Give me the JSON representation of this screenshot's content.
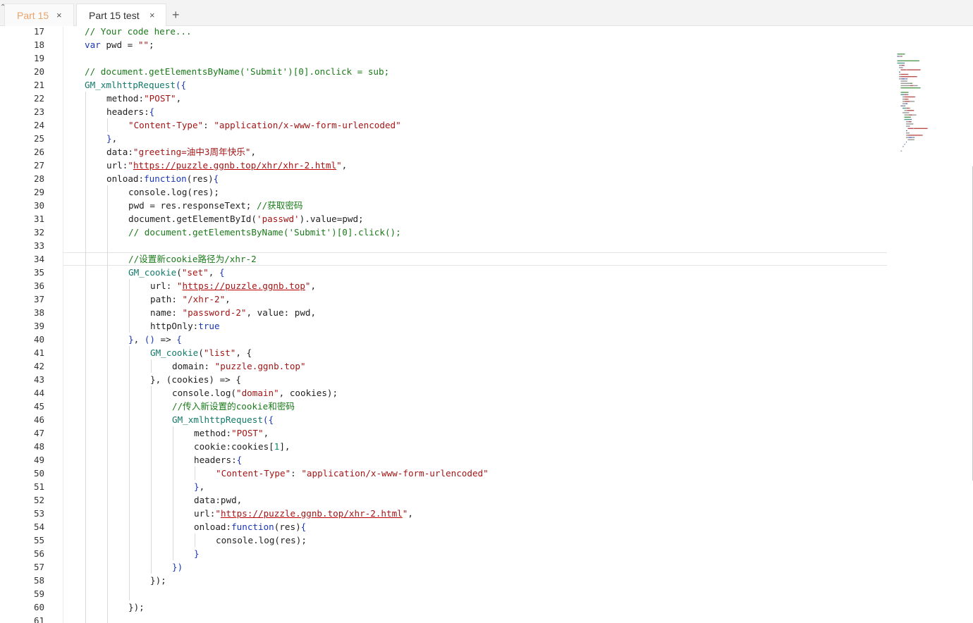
{
  "tabs": [
    {
      "label": "Part 15",
      "active": false
    },
    {
      "label": "Part 15 test",
      "active": true
    }
  ],
  "tab_close_glyph": "×",
  "add_tab_glyph": "+",
  "colors": {
    "comment": "#1a7a1a",
    "keyword": "#1a36b8",
    "string": "#a31515",
    "function": "#127a6a",
    "inactive_tab_text": "#e9a46a"
  },
  "editor": {
    "active_line": 34,
    "lines": [
      {
        "n": "17",
        "indent": 1,
        "tokens": [
          [
            "// Your code here...",
            "com"
          ]
        ]
      },
      {
        "n": "18",
        "indent": 1,
        "tokens": [
          [
            "var",
            "kw"
          ],
          [
            " pwd = ",
            ""
          ],
          [
            "\"\"",
            "str"
          ],
          [
            ";",
            ""
          ]
        ]
      },
      {
        "n": "19",
        "indent": 0,
        "tokens": []
      },
      {
        "n": "20",
        "indent": 1,
        "tokens": [
          [
            "// document.getElementsByName('Submit')[0].onclick = sub;",
            "com"
          ]
        ]
      },
      {
        "n": "21",
        "indent": 1,
        "tokens": [
          [
            "GM_xmlhttpRequest",
            "fn"
          ],
          [
            "({",
            "kw"
          ]
        ]
      },
      {
        "n": "22",
        "indent": 2,
        "tokens": [
          [
            "method:",
            ""
          ],
          [
            "\"POST\"",
            "str"
          ],
          [
            ",",
            ""
          ]
        ]
      },
      {
        "n": "23",
        "indent": 2,
        "tokens": [
          [
            "headers:",
            ""
          ],
          [
            "{",
            "kw"
          ]
        ]
      },
      {
        "n": "24",
        "indent": 3,
        "tokens": [
          [
            "\"Content-Type\"",
            "str"
          ],
          [
            ": ",
            ""
          ],
          [
            "\"application/x-www-form-urlencoded\"",
            "str"
          ]
        ]
      },
      {
        "n": "25",
        "indent": 2,
        "tokens": [
          [
            "}",
            "kw"
          ],
          [
            ",",
            ""
          ]
        ]
      },
      {
        "n": "26",
        "indent": 2,
        "tokens": [
          [
            "data:",
            ""
          ],
          [
            "\"greeting=油中3周年快乐\"",
            "str"
          ],
          [
            ",",
            ""
          ]
        ]
      },
      {
        "n": "27",
        "indent": 2,
        "tokens": [
          [
            "url:",
            ""
          ],
          [
            "\"",
            "str"
          ],
          [
            "https://puzzle.ggnb.top/xhr/xhr-2.html",
            "url"
          ],
          [
            "\"",
            "str"
          ],
          [
            ",",
            ""
          ]
        ]
      },
      {
        "n": "28",
        "indent": 2,
        "tokens": [
          [
            "onload:",
            ""
          ],
          [
            "function",
            "kw"
          ],
          [
            "(res)",
            ""
          ],
          [
            "{",
            "kw"
          ]
        ]
      },
      {
        "n": "29",
        "indent": 3,
        "tokens": [
          [
            "console.log(res);",
            ""
          ]
        ]
      },
      {
        "n": "30",
        "indent": 3,
        "tokens": [
          [
            "pwd = res.responseText; ",
            ""
          ],
          [
            "//获取密码",
            "com"
          ]
        ]
      },
      {
        "n": "31",
        "indent": 3,
        "tokens": [
          [
            "document.getElementById(",
            ""
          ],
          [
            "'passwd'",
            "str"
          ],
          [
            ").value=pwd;",
            ""
          ]
        ]
      },
      {
        "n": "32",
        "indent": 3,
        "tokens": [
          [
            "// document.getElementsByName('Submit')[0].click();",
            "com"
          ]
        ]
      },
      {
        "n": "33",
        "indent": 0,
        "tokens": []
      },
      {
        "n": "34",
        "indent": 3,
        "tokens": [
          [
            "//设置新cookie路径为/xhr-2",
            "com"
          ]
        ]
      },
      {
        "n": "35",
        "indent": 3,
        "tokens": [
          [
            "GM_cookie",
            "fn"
          ],
          [
            "(",
            ""
          ],
          [
            "\"set\"",
            "str"
          ],
          [
            ", ",
            ""
          ],
          [
            "{",
            "kw"
          ]
        ]
      },
      {
        "n": "36",
        "indent": 4,
        "tokens": [
          [
            "url: ",
            ""
          ],
          [
            "\"",
            "str"
          ],
          [
            "https://puzzle.ggnb.top",
            "url"
          ],
          [
            "\"",
            "str"
          ],
          [
            ",",
            ""
          ]
        ]
      },
      {
        "n": "37",
        "indent": 4,
        "tokens": [
          [
            "path: ",
            ""
          ],
          [
            "\"/xhr-2\"",
            "str"
          ],
          [
            ",",
            ""
          ]
        ]
      },
      {
        "n": "38",
        "indent": 4,
        "tokens": [
          [
            "name: ",
            ""
          ],
          [
            "\"password-2\"",
            "str"
          ],
          [
            ", value: pwd,",
            ""
          ]
        ]
      },
      {
        "n": "39",
        "indent": 4,
        "tokens": [
          [
            "httpOnly:",
            ""
          ],
          [
            "true",
            "kw"
          ]
        ]
      },
      {
        "n": "40",
        "indent": 3,
        "tokens": [
          [
            "}",
            "kw"
          ],
          [
            ", ",
            ""
          ],
          [
            "()",
            "kw"
          ],
          [
            " => ",
            ""
          ],
          [
            "{",
            "kw"
          ]
        ]
      },
      {
        "n": "41",
        "indent": 4,
        "tokens": [
          [
            "GM_cookie",
            "fn"
          ],
          [
            "(",
            ""
          ],
          [
            "\"list\"",
            "str"
          ],
          [
            ", {",
            ""
          ]
        ]
      },
      {
        "n": "42",
        "indent": 5,
        "tokens": [
          [
            "domain: ",
            ""
          ],
          [
            "\"puzzle.ggnb.top\"",
            "str"
          ]
        ]
      },
      {
        "n": "43",
        "indent": 4,
        "tokens": [
          [
            "}, (cookies) => {",
            ""
          ]
        ]
      },
      {
        "n": "44",
        "indent": 5,
        "tokens": [
          [
            "console.log(",
            ""
          ],
          [
            "\"domain\"",
            "str"
          ],
          [
            ", cookies);",
            ""
          ]
        ]
      },
      {
        "n": "45",
        "indent": 5,
        "tokens": [
          [
            "//传入新设置的cookie和密码",
            "com"
          ]
        ]
      },
      {
        "n": "46",
        "indent": 5,
        "tokens": [
          [
            "GM_xmlhttpRequest",
            "fn"
          ],
          [
            "({",
            "kw"
          ]
        ]
      },
      {
        "n": "47",
        "indent": 6,
        "tokens": [
          [
            "method:",
            ""
          ],
          [
            "\"POST\"",
            "str"
          ],
          [
            ",",
            ""
          ]
        ]
      },
      {
        "n": "48",
        "indent": 6,
        "tokens": [
          [
            "cookie:cookies[",
            ""
          ],
          [
            "1",
            "num"
          ],
          [
            "],",
            ""
          ]
        ]
      },
      {
        "n": "49",
        "indent": 6,
        "tokens": [
          [
            "headers:",
            ""
          ],
          [
            "{",
            "kw"
          ]
        ]
      },
      {
        "n": "50",
        "indent": 7,
        "tokens": [
          [
            "\"Content-Type\"",
            "str"
          ],
          [
            ": ",
            ""
          ],
          [
            "\"application/x-www-form-urlencoded\"",
            "str"
          ]
        ]
      },
      {
        "n": "51",
        "indent": 6,
        "tokens": [
          [
            "}",
            "kw"
          ],
          [
            ",",
            ""
          ]
        ]
      },
      {
        "n": "52",
        "indent": 6,
        "tokens": [
          [
            "data:pwd,",
            ""
          ]
        ]
      },
      {
        "n": "53",
        "indent": 6,
        "tokens": [
          [
            "url:",
            ""
          ],
          [
            "\"",
            "str"
          ],
          [
            "https://puzzle.ggnb.top/xhr-2.html",
            "url"
          ],
          [
            "\"",
            "str"
          ],
          [
            ",",
            ""
          ]
        ]
      },
      {
        "n": "54",
        "indent": 6,
        "tokens": [
          [
            "onload:",
            ""
          ],
          [
            "function",
            "kw"
          ],
          [
            "(res)",
            ""
          ],
          [
            "{",
            "kw"
          ]
        ]
      },
      {
        "n": "55",
        "indent": 7,
        "tokens": [
          [
            "console.log(res);",
            ""
          ]
        ]
      },
      {
        "n": "56",
        "indent": 6,
        "tokens": [
          [
            "}",
            "kw"
          ]
        ]
      },
      {
        "n": "57",
        "indent": 5,
        "tokens": [
          [
            "})",
            "kw"
          ]
        ]
      },
      {
        "n": "58",
        "indent": 4,
        "tokens": [
          [
            "});",
            ""
          ]
        ]
      },
      {
        "n": "59",
        "indent": 0,
        "tokens": []
      },
      {
        "n": "60",
        "indent": 3,
        "tokens": [
          [
            "});",
            ""
          ]
        ]
      },
      {
        "n": "61",
        "indent": 0,
        "tokens": []
      }
    ]
  }
}
